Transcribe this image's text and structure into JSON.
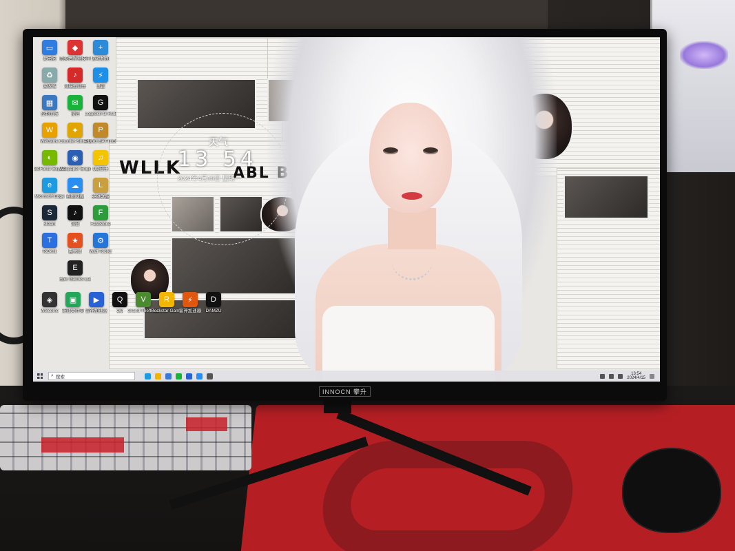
{
  "wallpaper": {
    "weather_label": "天气",
    "clock_hours": "13",
    "clock_minutes": "54",
    "date_text": "2024年4月15日 星期一",
    "headline_left": "WLLK",
    "headline_right": "ABL BFAET"
  },
  "desktop_icons": [
    {
      "label": "此电脑",
      "color": "#2f7de1",
      "glyph": "▭",
      "icon": "computer-icon"
    },
    {
      "label": "完美世界竞技平台",
      "color": "#d33",
      "glyph": "◆",
      "icon": "game-platform-icon"
    },
    {
      "label": "游戏加加",
      "color": "#2b8bd9",
      "glyph": "+",
      "icon": "game-plus-icon"
    },
    {
      "label": "回收站",
      "color": "#8aa",
      "glyph": "♻",
      "icon": "recycle-bin-icon"
    },
    {
      "label": "网易云音乐",
      "color": "#d42a2a",
      "glyph": "♪",
      "icon": "music-icon"
    },
    {
      "label": "迅雷",
      "color": "#1e8fe6",
      "glyph": "⚡",
      "icon": "thunder-icon"
    },
    {
      "label": "控制面板",
      "color": "#3a78c2",
      "glyph": "▦",
      "icon": "control-panel-icon"
    },
    {
      "label": "微信",
      "color": "#17b33a",
      "glyph": "✉",
      "icon": "wechat-icon"
    },
    {
      "label": "Logitech G HUB",
      "color": "#111",
      "glyph": "G",
      "icon": "logitech-icon"
    },
    {
      "label": "WeGame",
      "color": "#e8a100",
      "glyph": "W",
      "icon": "wegame-icon"
    },
    {
      "label": "Counter-Strike 2",
      "color": "#e0a500",
      "glyph": "✦",
      "icon": "cs2-icon"
    },
    {
      "label": "PUBG BATTLEGROUNDS",
      "color": "#c08a2a",
      "glyph": "P",
      "icon": "pubg-icon"
    },
    {
      "label": "GeForce Experience",
      "color": "#76b900",
      "glyph": "◐",
      "icon": "geforce-icon"
    },
    {
      "label": "Wallpaper Engine",
      "color": "#2a5fb3",
      "glyph": "◉",
      "icon": "wallpaper-engine-icon"
    },
    {
      "label": "QQ音乐",
      "color": "#f5c400",
      "glyph": "♫",
      "icon": "qq-music-icon"
    },
    {
      "label": "Microsoft Edge",
      "color": "#1e9be0",
      "glyph": "e",
      "icon": "edge-icon"
    },
    {
      "label": "百度网盘",
      "color": "#2a8ef0",
      "glyph": "☁",
      "icon": "baidu-pan-icon"
    },
    {
      "label": "英雄联盟",
      "color": "#c8a040",
      "glyph": "L",
      "icon": "lol-icon"
    },
    {
      "label": "Steam",
      "color": "#1b2838",
      "glyph": "S",
      "icon": "steam-icon"
    },
    {
      "label": "抖音",
      "color": "#111",
      "glyph": "♪",
      "icon": "douyin-icon"
    },
    {
      "label": "FastStone",
      "color": "#2d9c3a",
      "glyph": "F",
      "icon": "faststone-icon"
    },
    {
      "label": "ToDesk",
      "color": "#2b6fe0",
      "glyph": "T",
      "icon": "todesk-icon"
    },
    {
      "label": "鲁大师",
      "color": "#e5501f",
      "glyph": "★",
      "icon": "ludashi-icon"
    },
    {
      "label": "Watt Toolkit",
      "color": "#2576d9",
      "glyph": "⚙",
      "icon": "watt-toolkit-icon"
    },
    {
      "label": "Epic Games Launcher",
      "color": "#222",
      "glyph": "E",
      "icon": "epic-icon"
    },
    {
      "label": "Welcome",
      "color": "#333",
      "glyph": "◈",
      "icon": "welcome-icon"
    },
    {
      "label": "新建文件夹",
      "color": "#23a85a",
      "glyph": "▣",
      "icon": "folder-icon"
    },
    {
      "label": "雷神加速器",
      "color": "#2962d4",
      "glyph": "▶",
      "icon": "accelerator-icon"
    },
    {
      "label": "QQ",
      "color": "#111",
      "glyph": "Q",
      "icon": "qq-icon"
    },
    {
      "label": "Grand Theft Auto V",
      "color": "#4b8a2f",
      "glyph": "V",
      "icon": "gta-icon"
    },
    {
      "label": "Rockstar Games",
      "color": "#f2b600",
      "glyph": "R",
      "icon": "rockstar-icon"
    },
    {
      "label": "雷神加速器",
      "color": "#e2570e",
      "glyph": "⚡",
      "icon": "thunder-accelerator-icon"
    },
    {
      "label": "DAMZU",
      "color": "#111",
      "glyph": "D",
      "icon": "damzu-icon"
    }
  ],
  "taskbar": {
    "search_placeholder": "搜索",
    "time": "13:54",
    "date": "2024/4/15",
    "app_colors": [
      "#1e9be0",
      "#f0b400",
      "#3a7bd5",
      "#17b33a",
      "#2962d4",
      "#2a8ef0",
      "#555"
    ]
  },
  "monitor": {
    "brand": "INNOCN 攀升"
  }
}
